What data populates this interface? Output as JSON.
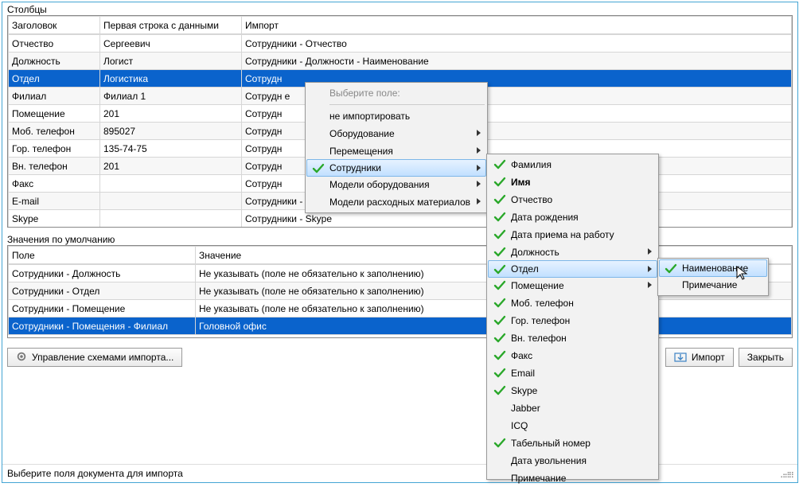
{
  "columns_section_label": "Столбцы",
  "defaults_section_label": "Значения по умолчанию",
  "columns_headers": {
    "h1": "Заголовок",
    "h2": "Первая строка с данными",
    "h3": "Импорт"
  },
  "columns_rows": [
    {
      "c1": "Отчество",
      "c2": "Сергеевич",
      "c3": "Сотрудники - Отчество",
      "selected": false
    },
    {
      "c1": "Должность",
      "c2": "Логист",
      "c3": "Сотрудники - Должности - Наименование",
      "selected": false
    },
    {
      "c1": "Отдел",
      "c2": "Логистика",
      "c3": "Сотрудн",
      "selected": true
    },
    {
      "c1": "Филиал",
      "c2": "Филиал 1",
      "c3": "Сотрудн                                                           е",
      "selected": false
    },
    {
      "c1": "Помещение",
      "c2": "201",
      "c3": "Сотрудн",
      "selected": false
    },
    {
      "c1": "Моб. телефон",
      "c2": "895027",
      "c3": "Сотрудн",
      "selected": false
    },
    {
      "c1": "Гор. телефон",
      "c2": "135-74-75",
      "c3": "Сотрудн",
      "selected": false
    },
    {
      "c1": "Вн. телефон",
      "c2": "201",
      "c3": "Сотрудн",
      "selected": false
    },
    {
      "c1": "Факс",
      "c2": "",
      "c3": "Сотрудн",
      "selected": false
    },
    {
      "c1": "E-mail",
      "c2": "",
      "c3": "Сотрудники - Email",
      "selected": false
    },
    {
      "c1": "Skype",
      "c2": "",
      "c3": "Сотрудники - Skype",
      "selected": false
    }
  ],
  "defaults_headers": {
    "h1": "Поле",
    "h2": "Значение"
  },
  "defaults_rows": [
    {
      "c1": "Сотрудники - Должность",
      "c2": "Не указывать (поле не обязательно к заполнению)",
      "selected": false
    },
    {
      "c1": "Сотрудники - Отдел",
      "c2": "Не указывать (поле не обязательно к заполнению)",
      "selected": false
    },
    {
      "c1": "Сотрудники - Помещение",
      "c2": "Не указывать (поле не обязательно к заполнению)",
      "selected": false
    },
    {
      "c1": "Сотрудники - Помещения - Филиал",
      "c2": "Головной офис",
      "selected": true
    }
  ],
  "menu1": {
    "header": "Выберите поле:",
    "items": [
      {
        "label": "не импортировать",
        "sub": false,
        "check": false
      },
      {
        "label": "Оборудование",
        "sub": true,
        "check": false
      },
      {
        "label": "Перемещения",
        "sub": true,
        "check": false
      },
      {
        "label": "Сотрудники",
        "sub": true,
        "check": true,
        "selected": true
      },
      {
        "label": "Модели оборудования",
        "sub": true,
        "check": false
      },
      {
        "label": "Модели расходных материалов",
        "sub": true,
        "check": false
      }
    ]
  },
  "menu2": {
    "items": [
      {
        "label": "Фамилия",
        "check": true
      },
      {
        "label": "Имя",
        "check": true,
        "bold": true
      },
      {
        "label": "Отчество",
        "check": true
      },
      {
        "label": "Дата рождения",
        "check": true
      },
      {
        "label": "Дата приема на работу",
        "check": true
      },
      {
        "label": "Должность",
        "sub": true,
        "check": true
      },
      {
        "label": "Отдел",
        "sub": true,
        "check": true,
        "selected": true
      },
      {
        "label": "Помещение",
        "sub": true,
        "check": true
      },
      {
        "label": "Моб. телефон",
        "check": true
      },
      {
        "label": "Гор. телефон",
        "check": true
      },
      {
        "label": "Вн. телефон",
        "check": true
      },
      {
        "label": "Факс",
        "check": true
      },
      {
        "label": "Email",
        "check": true
      },
      {
        "label": "Skype",
        "check": true
      },
      {
        "label": "Jabber",
        "check": false
      },
      {
        "label": "ICQ",
        "check": false
      },
      {
        "label": "Табельный номер",
        "check": true
      },
      {
        "label": "Дата увольнения",
        "check": false
      },
      {
        "label": "Примечание",
        "check": false
      }
    ]
  },
  "menu3": {
    "items": [
      {
        "label": "Наименование",
        "check": true,
        "selected": true
      },
      {
        "label": "Примечание",
        "check": false
      }
    ]
  },
  "buttons": {
    "manage": "Управление схемами импорта...",
    "import": "Импорт",
    "close": "Закрыть"
  },
  "status": "Выберите поля документа для импорта"
}
